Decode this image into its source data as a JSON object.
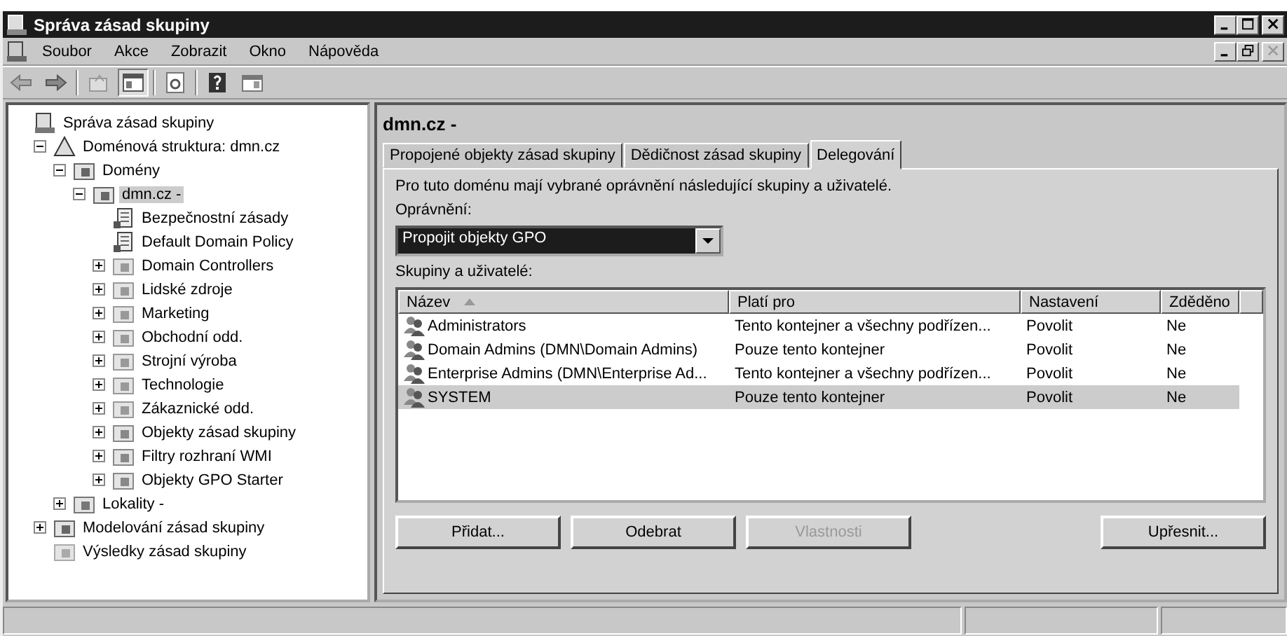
{
  "window": {
    "title": "Správa zásad skupiny"
  },
  "menu": [
    "Soubor",
    "Akce",
    "Zobrazit",
    "Okno",
    "Nápověda"
  ],
  "tree": [
    {
      "label": "Správa zásad skupiny",
      "kind": "console",
      "selected": false,
      "children": [
        {
          "label": "Doménová struktura: dmn.cz",
          "kind": "forest",
          "expanded": true,
          "selected": false,
          "children": [
            {
              "label": "Domény",
              "kind": "domains",
              "expanded": true,
              "selected": false,
              "children": [
                {
                  "label": "dmn.cz -",
                  "kind": "domain",
                  "expanded": true,
                  "selected": true,
                  "children": [
                    {
                      "label": "Bezpečnostní zásady",
                      "kind": "gpo",
                      "selected": false
                    },
                    {
                      "label": "Default Domain Policy",
                      "kind": "gpo",
                      "selected": false
                    },
                    {
                      "label": "Domain Controllers",
                      "kind": "ou",
                      "expanded": false,
                      "selected": false
                    },
                    {
                      "label": "Lidské zdroje",
                      "kind": "ou",
                      "expanded": false,
                      "selected": false
                    },
                    {
                      "label": "Marketing",
                      "kind": "ou",
                      "expanded": false,
                      "selected": false
                    },
                    {
                      "label": "Obchodní odd.",
                      "kind": "ou",
                      "expanded": false,
                      "selected": false
                    },
                    {
                      "label": "Strojní výroba",
                      "kind": "ou",
                      "expanded": false,
                      "selected": false
                    },
                    {
                      "label": "Technologie",
                      "kind": "ou",
                      "expanded": false,
                      "selected": false
                    },
                    {
                      "label": "Zákaznické odd.",
                      "kind": "ou",
                      "expanded": false,
                      "selected": false
                    },
                    {
                      "label": "Objekty zásad skupiny",
                      "kind": "container",
                      "expanded": false,
                      "selected": false
                    },
                    {
                      "label": "Filtry rozhraní WMI",
                      "kind": "filter",
                      "expanded": false,
                      "selected": false
                    },
                    {
                      "label": "Objekty GPO Starter",
                      "kind": "container",
                      "expanded": false,
                      "selected": false
                    }
                  ]
                }
              ]
            },
            {
              "label": "Lokality -",
              "kind": "sites",
              "expanded": false,
              "selected": false
            }
          ]
        },
        {
          "label": "Modelování zásad skupiny",
          "kind": "modeling",
          "expanded": false,
          "selected": false
        },
        {
          "label": "Výsledky zásad skupiny",
          "kind": "results",
          "selected": false
        }
      ]
    }
  ],
  "detail": {
    "title": "dmn.cz -",
    "tabs": [
      {
        "label": "Propojené objekty zásad skupiny",
        "selected": false
      },
      {
        "label": "Dědičnost zásad skupiny",
        "selected": false
      },
      {
        "label": "Delegování",
        "selected": true
      }
    ],
    "description": "Pro tuto doménu mají vybrané oprávnění následující skupiny a uživatelé.",
    "permission_label": "Oprávnění:",
    "permission_value": "Propojit objekty GPO",
    "list_label": "Skupiny a uživatelé:",
    "columns": [
      {
        "label": "Název",
        "sorted": true
      },
      {
        "label": "Platí pro",
        "sorted": false
      },
      {
        "label": "Nastavení",
        "sorted": false
      },
      {
        "label": "Zděděno",
        "sorted": false
      }
    ],
    "rows": [
      {
        "cells": [
          "Administrators",
          "Tento kontejner a všechny podřízen...",
          "Povolit",
          "Ne"
        ],
        "selected": false
      },
      {
        "cells": [
          "Domain Admins (DMN\\Domain Admins)",
          "Pouze tento kontejner",
          "Povolit",
          "Ne"
        ],
        "selected": false
      },
      {
        "cells": [
          "Enterprise Admins (DMN\\Enterprise Ad...",
          "Tento kontejner a všechny podřízen...",
          "Povolit",
          "Ne"
        ],
        "selected": false
      },
      {
        "cells": [
          "SYSTEM",
          "Pouze tento kontejner",
          "Povolit",
          "Ne"
        ],
        "selected": true
      }
    ],
    "buttons": [
      {
        "label": "Přidat...",
        "disabled": false
      },
      {
        "label": "Odebrat",
        "disabled": false
      },
      {
        "label": "Vlastnosti",
        "disabled": true
      },
      {
        "label": "Upřesnit...",
        "disabled": false
      }
    ]
  }
}
